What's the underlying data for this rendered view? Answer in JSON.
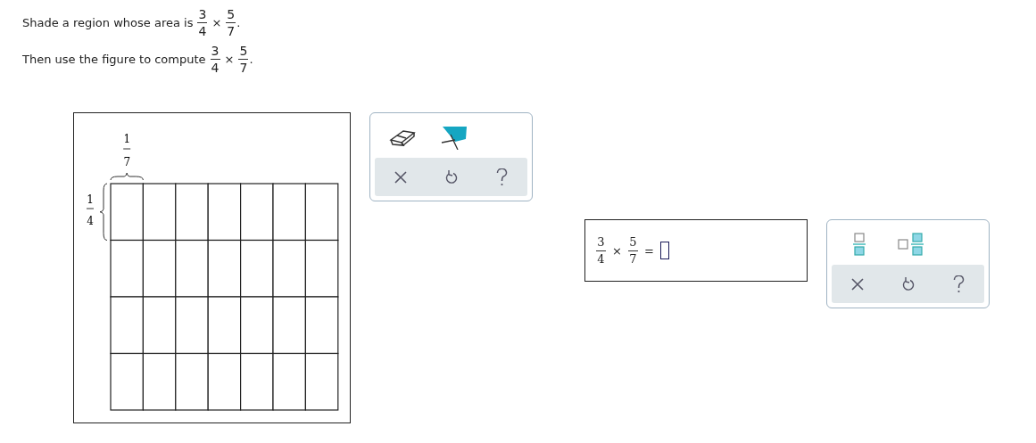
{
  "prompt": [
    {
      "text": "Shade a region whose area is",
      "factors": [
        {
          "numerator": "3",
          "denominator": "4"
        },
        {
          "numerator": "5",
          "denominator": "7"
        }
      ],
      "operator": "×",
      "end": "."
    },
    {
      "text": "Then use the figure to compute",
      "factors": [
        {
          "numerator": "3",
          "denominator": "4"
        },
        {
          "numerator": "5",
          "denominator": "7"
        }
      ],
      "operator": "×",
      "end": "."
    }
  ],
  "figure": {
    "column_label": {
      "numerator": "1",
      "denominator": "7"
    },
    "row_label": {
      "numerator": "1",
      "denominator": "4"
    },
    "rows": [
      {
        "cells": [
          {
            "shaded": false
          },
          {
            "shaded": false
          },
          {
            "shaded": false
          },
          {
            "shaded": false
          },
          {
            "shaded": false
          },
          {
            "shaded": false
          },
          {
            "shaded": false
          }
        ]
      },
      {
        "cells": [
          {
            "shaded": false
          },
          {
            "shaded": false
          },
          {
            "shaded": false
          },
          {
            "shaded": false
          },
          {
            "shaded": false
          },
          {
            "shaded": false
          },
          {
            "shaded": false
          }
        ]
      },
      {
        "cells": [
          {
            "shaded": false
          },
          {
            "shaded": false
          },
          {
            "shaded": false
          },
          {
            "shaded": false
          },
          {
            "shaded": false
          },
          {
            "shaded": false
          },
          {
            "shaded": false
          }
        ]
      },
      {
        "cells": [
          {
            "shaded": false
          },
          {
            "shaded": false
          },
          {
            "shaded": false
          },
          {
            "shaded": false
          },
          {
            "shaded": false
          },
          {
            "shaded": false
          },
          {
            "shaded": false
          }
        ]
      }
    ]
  },
  "figure_toolbar": {
    "tools": [
      {
        "kind": "eraser"
      },
      {
        "kind": "shade"
      }
    ],
    "actions": [
      {
        "kind": "clear"
      },
      {
        "kind": "undo"
      },
      {
        "kind": "help"
      }
    ]
  },
  "answer": {
    "factors": [
      {
        "numerator": "3",
        "denominator": "4"
      },
      {
        "numerator": "5",
        "denominator": "7"
      }
    ],
    "operator": "×",
    "equals": "="
  },
  "answer_toolbar": {
    "tools": [
      {
        "kind": "fraction"
      },
      {
        "kind": "mixed-number"
      }
    ],
    "actions": [
      {
        "kind": "clear"
      },
      {
        "kind": "undo"
      },
      {
        "kind": "help"
      }
    ]
  }
}
